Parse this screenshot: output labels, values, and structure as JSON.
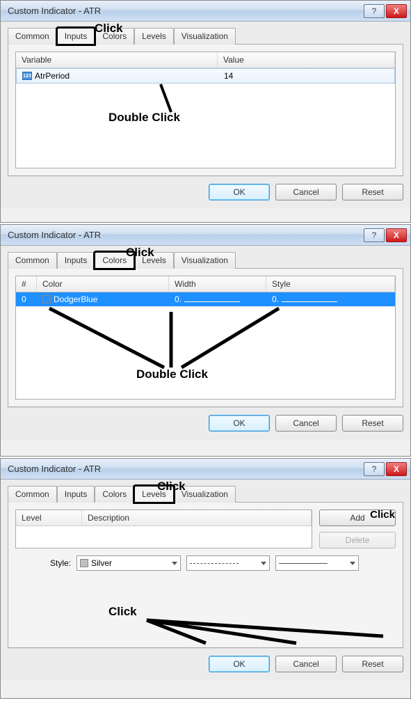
{
  "dialogs": [
    {
      "title": "Custom Indicator - ATR",
      "active_tab": "Inputs",
      "annotation_top": "Click",
      "annotation_mid": "Double Click",
      "tabs": [
        "Common",
        "Inputs",
        "Colors",
        "Levels",
        "Visualization"
      ],
      "columns": [
        "Variable",
        "Value"
      ],
      "row": {
        "icon": "123",
        "variable": "AtrPeriod",
        "value": "14"
      },
      "buttons": {
        "ok": "OK",
        "cancel": "Cancel",
        "reset": "Reset"
      }
    },
    {
      "title": "Custom Indicator - ATR",
      "active_tab": "Colors",
      "annotation_top": "Click",
      "annotation_mid": "Double Click",
      "tabs": [
        "Common",
        "Inputs",
        "Colors",
        "Levels",
        "Visualization"
      ],
      "columns": [
        "#",
        "Color",
        "Width",
        "Style"
      ],
      "row": {
        "num": "0",
        "color_name": "DodgerBlue",
        "color_hex": "#1e90ff",
        "width": "0.",
        "style": "0."
      },
      "buttons": {
        "ok": "OK",
        "cancel": "Cancel",
        "reset": "Reset"
      }
    },
    {
      "title": "Custom Indicator - ATR",
      "active_tab": "Levels",
      "annotation_top": "Click",
      "annotation_right": "Click",
      "annotation_mid": "Click",
      "tabs": [
        "Common",
        "Inputs",
        "Colors",
        "Levels",
        "Visualization"
      ],
      "columns": [
        "Level",
        "Description"
      ],
      "side_buttons": {
        "add": "Add",
        "delete": "Delete"
      },
      "style_label": "Style:",
      "style_color": "Silver",
      "buttons": {
        "ok": "OK",
        "cancel": "Cancel",
        "reset": "Reset"
      }
    }
  ],
  "help_icon": "?",
  "close_icon": "X"
}
